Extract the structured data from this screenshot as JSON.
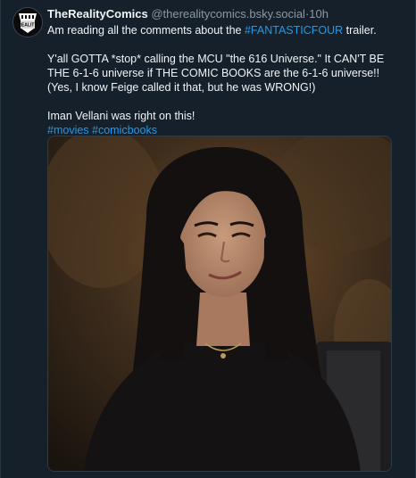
{
  "post": {
    "display_name": "TheRealityComics",
    "handle": "@therealitycomics.bsky.social",
    "separator": "·",
    "time": "10h",
    "line1_prefix": "Am reading all the comments about the ",
    "line1_hashtag": "#FANTASTICFOUR",
    "line1_suffix": " trailer.",
    "paragraph2": "Y'all GOTTA *stop* calling the MCU \"the 616 Universe.\" It CAN'T BE THE 6-1-6 universe if THE COMIC BOOKS are the 6-1-6 universe!! (Yes, I know Feige called it that, but he was WRONG!)",
    "paragraph3": "Iman Vellani was right on this!",
    "hashtags": [
      "#movies",
      "#comicbooks"
    ]
  },
  "avatar": {
    "icon": "comics-logo-avatar",
    "logo_text": "REALITY"
  },
  "media": {
    "icon": "photo-person-smiling"
  },
  "colors": {
    "background": "#15202b",
    "link": "#1d9bf0",
    "muted": "#8b98a5"
  }
}
